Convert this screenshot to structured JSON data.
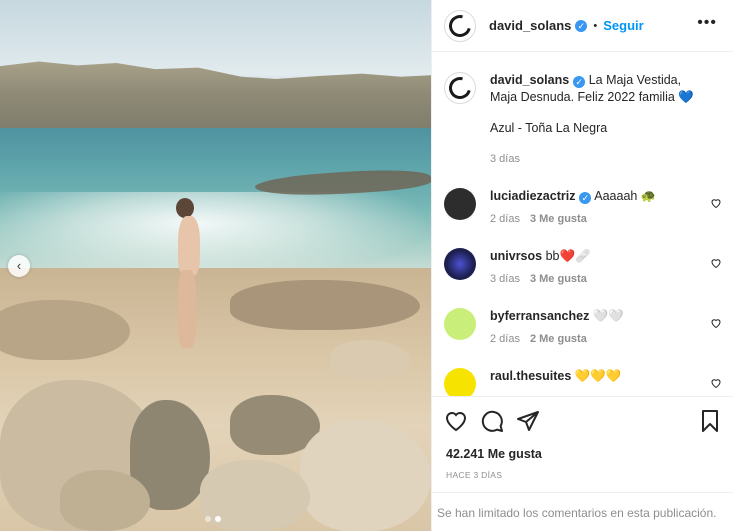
{
  "post": {
    "author": "david_solans",
    "follow_label": "Seguir",
    "separator": "•",
    "more_label": "•••",
    "caption_line1": "La Maja Vestida, Maja Desnuda. Feliz 2022 familia",
    "caption_emoji": "💙",
    "caption_line2": "Azul - Toña La Negra",
    "caption_time": "3 días",
    "likes": "42.241 Me gusta",
    "posted_ago": "HACE 3 DÍAS",
    "comments_limited": "Se han limitado los comentarios en esta publicación."
  },
  "carousel": {
    "prev_icon": "‹",
    "slides": 2,
    "active_slide": 2
  },
  "comments": [
    {
      "user": "luciadiezactriz",
      "verified": true,
      "text": "Aaaaah 🐢",
      "time": "2 días",
      "likes": "3 Me gusta",
      "reply": "",
      "avatar_color": "#2d2d2d"
    },
    {
      "user": "univrsos",
      "verified": false,
      "text": "bb❤️🩹",
      "time": "3 días",
      "likes": "3 Me gusta",
      "reply": "",
      "avatar_color": "#1d1f4f"
    },
    {
      "user": "byferransanchez",
      "verified": false,
      "text": "🤍🤍",
      "time": "2 días",
      "likes": "2 Me gusta",
      "reply": "",
      "avatar_color": "#c9ef7a"
    },
    {
      "user": "raul.thesuites",
      "verified": false,
      "text": "💛💛💛",
      "time": "",
      "likes": "",
      "reply": "",
      "avatar_color": "#f6e400"
    }
  ],
  "icons": {
    "verified": "✓",
    "like": "heart-icon",
    "comment": "comment-icon",
    "share": "share-icon",
    "save": "bookmark-icon"
  },
  "colors": {
    "accent": "#0095f6",
    "verified": "#3897f0",
    "meta": "#8e8e8e",
    "heart_red": "#ed4956"
  }
}
